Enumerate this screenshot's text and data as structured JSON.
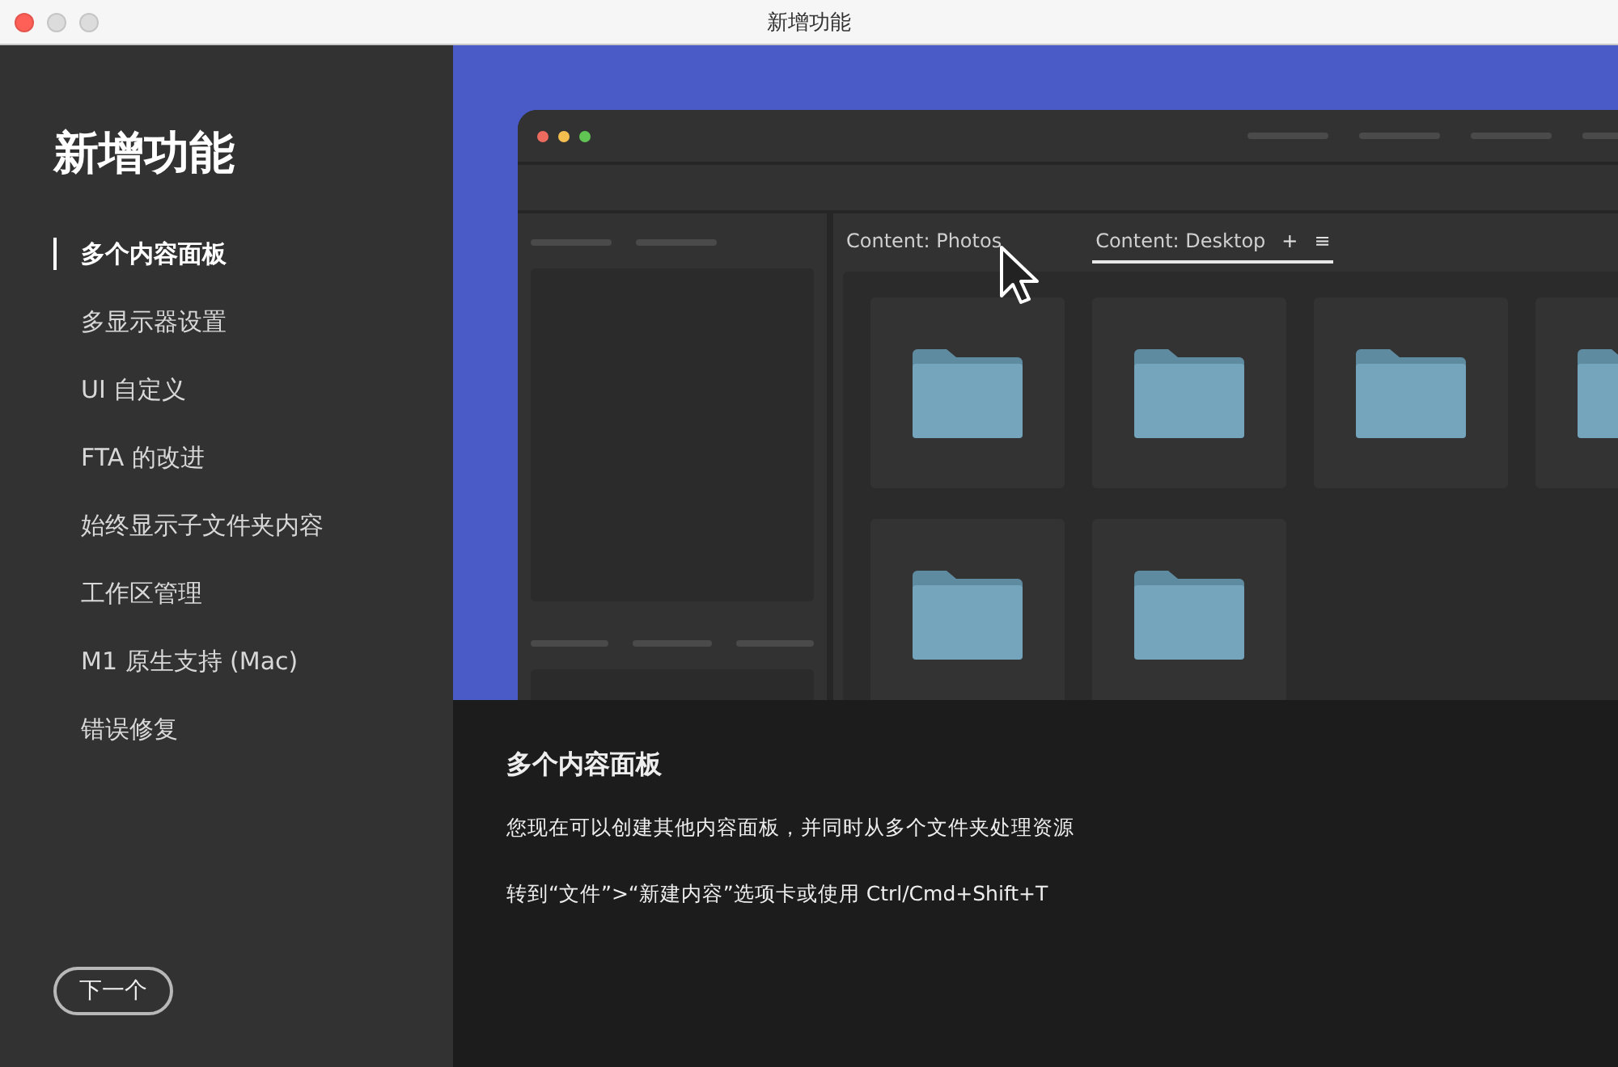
{
  "window": {
    "title": "新增功能"
  },
  "sidebar": {
    "title": "新增功能",
    "items": [
      {
        "label": "多个内容面板",
        "selected": true
      },
      {
        "label": "多显示器设置",
        "selected": false
      },
      {
        "label": "UI 自定义",
        "selected": false
      },
      {
        "label": "FTA 的改进",
        "selected": false
      },
      {
        "label": "始终显示子文件夹内容",
        "selected": false
      },
      {
        "label": "工作区管理",
        "selected": false
      },
      {
        "label": "M1 原生支持 (Mac)",
        "selected": false
      },
      {
        "label": "错误修复",
        "selected": false
      }
    ],
    "next_button": "下一个"
  },
  "illustration": {
    "tabs": [
      {
        "label": "Content: Photos",
        "selected": false
      },
      {
        "label": "Content: Desktop",
        "selected": true
      }
    ],
    "add_glyph": "+",
    "menu_glyph": "≡"
  },
  "detail": {
    "heading": "多个内容面板",
    "paragraphs": [
      "您现在可以创建其他内容面板，并同时从多个文件夹处理资源",
      "转到“文件”>“新建内容”选项卡或使用 Ctrl/Cmd+Shift+T"
    ]
  }
}
